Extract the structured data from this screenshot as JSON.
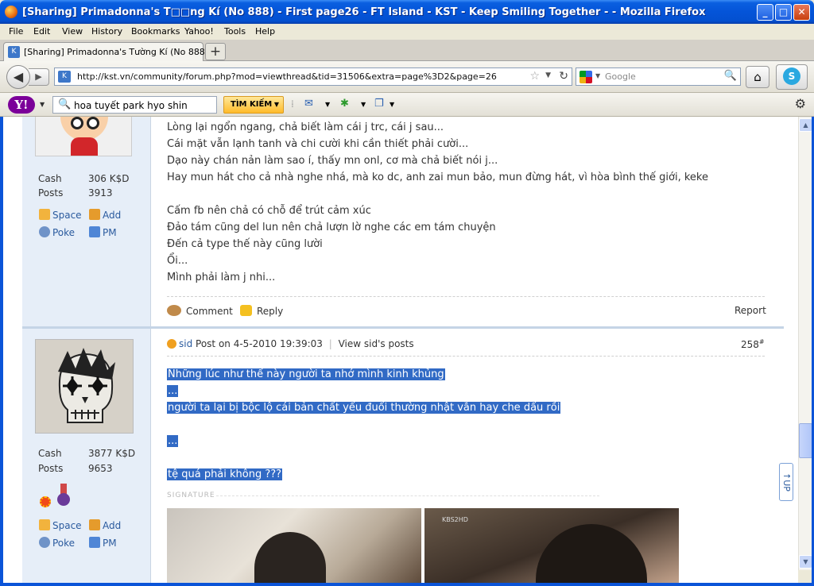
{
  "window": {
    "title": "[Sharing] Primadonna's T□□ng Kí (No 888) - First page26 - FT Island - KST - Keep Smiling Together - - Mozilla Firefox",
    "min": "_",
    "max": "□",
    "close": "✕"
  },
  "menu": [
    "File",
    "Edit",
    "View",
    "History",
    "Bookmarks",
    "Yahoo!",
    "Tools",
    "Help"
  ],
  "tab": {
    "title": "[Sharing] Primadonna's Tường Kí (No 888) - ...",
    "new": "+"
  },
  "nav": {
    "url": "http://kst.vn/community/forum.php?mod=viewthread&tid=31506&extra=page%3D2&page=26",
    "search_placeholder": "Google"
  },
  "yahoo": {
    "logo": "Y!",
    "search_value": "hoa tuyết park hyo shin",
    "search_button": "TÌM KIẾM"
  },
  "post1": {
    "lines": [
      "Lòng lại ngổn ngang, chả biết làm cái j trc, cái j sau...",
      "Cái mặt vẫn lạnh tanh và chi cười khi cần thiết phải cười...",
      "Dạo này chán nản làm sao í, thấy mn onl, cơ mà chả biết nói j...",
      "Hay mun hát cho cả nhà nghe nhá, mà ko dc, anh zai mun bảo, mun đừng hát, vì hòa bình thế giới, keke",
      "Cấm fb nên chả có chỗ để trút cảm xúc",
      "Đảo tám cũng del lun nên chả lượn lờ nghe các em tám chuyện",
      "Đến cả type thế này cũng lười",
      "Ổi...",
      "Mình phải làm j nhi..."
    ],
    "cash_label": "Cash",
    "cash_value": "306 K$D",
    "posts_label": "Posts",
    "posts_value": "3913",
    "space": "Space",
    "add": "Add",
    "poke": "Poke",
    "pm": "PM",
    "comment": "Comment",
    "reply": "Reply",
    "report": "Report"
  },
  "post2": {
    "author": "sid",
    "meta": "Post on 4-5-2010 19:39:03",
    "sep": "|",
    "view_posts": "View sid's posts",
    "number": "258",
    "number_sup": "#",
    "lines": [
      "Những lúc như thế này người ta nhớ mình kinh khủng",
      "...",
      "người ta lại bị bộc lộ cái bản chất yếu đuối thường nhật vẫn hay che dấu rồi",
      "...",
      "tệ quá phải không ???"
    ],
    "signature": "SIGNATURE",
    "cash_label": "Cash",
    "cash_value": "3877 K$D",
    "posts_label": "Posts",
    "posts_value": "9653",
    "space": "Space",
    "add": "Add",
    "poke": "Poke",
    "pm": "PM",
    "sig_watermark": "KBS2HD"
  },
  "back_to_top": "↑UP"
}
